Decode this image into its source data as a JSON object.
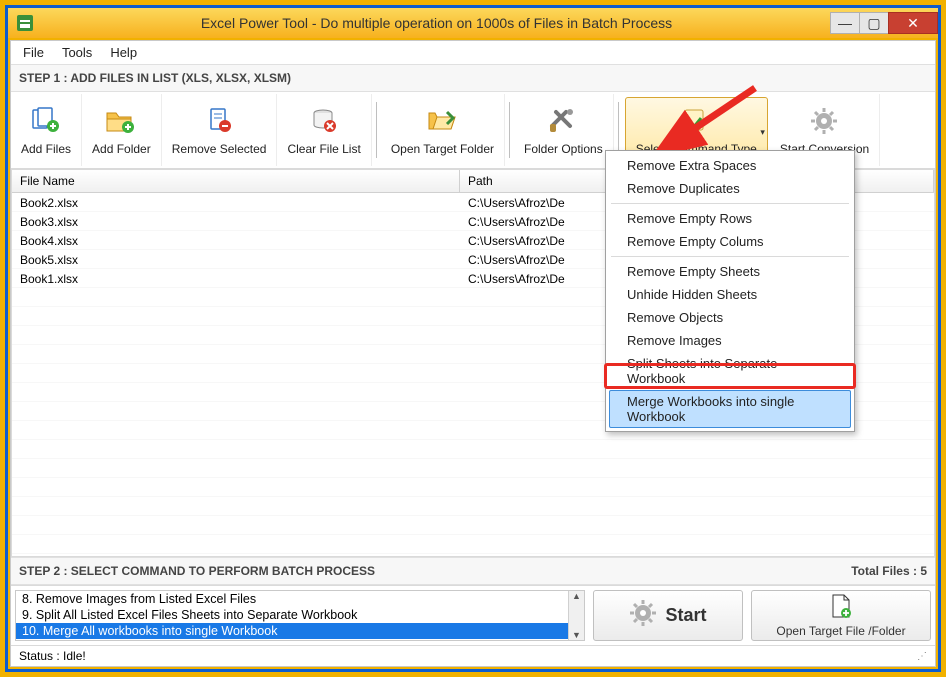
{
  "window": {
    "title": "Excel Power Tool - Do multiple operation on 1000s of Files in Batch Process"
  },
  "menubar": {
    "file": "File",
    "tools": "Tools",
    "help": "Help"
  },
  "step1_label": "STEP 1 : ADD FILES IN LIST (XLS, XLSX, XLSM)",
  "toolbar": {
    "add_files": "Add Files",
    "add_folder": "Add Folder",
    "remove_selected": "Remove Selected",
    "clear_file_list": "Clear File List",
    "open_target_folder": "Open Target Folder",
    "folder_options": "Folder Options",
    "select_command_type": "Select Command Type",
    "start_conversion": "Start Conversion"
  },
  "columns": {
    "name": "File Name",
    "path": "Path"
  },
  "files": [
    {
      "name": "Book2.xlsx",
      "path": "C:\\Users\\Afroz\\De"
    },
    {
      "name": "Book3.xlsx",
      "path": "C:\\Users\\Afroz\\De"
    },
    {
      "name": "Book4.xlsx",
      "path": "C:\\Users\\Afroz\\De"
    },
    {
      "name": "Book5.xlsx",
      "path": "C:\\Users\\Afroz\\De"
    },
    {
      "name": "Book1.xlsx",
      "path": "C:\\Users\\Afroz\\De"
    }
  ],
  "dropdown": {
    "g1": [
      "Remove Extra Spaces",
      "Remove Duplicates"
    ],
    "g2": [
      "Remove Empty Rows",
      "Remove Empty Colums"
    ],
    "g3": [
      "Remove Empty Sheets",
      "Unhide Hidden Sheets",
      "Remove Objects",
      "Remove Images",
      "Split Sheets into Separate Workbook",
      "Merge Workbooks into single Workbook"
    ]
  },
  "step2_label": "STEP 2 : SELECT COMMAND TO PERFORM BATCH PROCESS",
  "total_files_label": "Total Files : 5",
  "cmd_list": [
    "8. Remove Images from Listed Excel Files",
    "9. Split All Listed Excel Files Sheets into Separate Workbook",
    "10. Merge All workbooks into single Workbook"
  ],
  "start_label": "Start",
  "open_target_btn": "Open Target File /Folder",
  "status": "Status  :  Idle!"
}
